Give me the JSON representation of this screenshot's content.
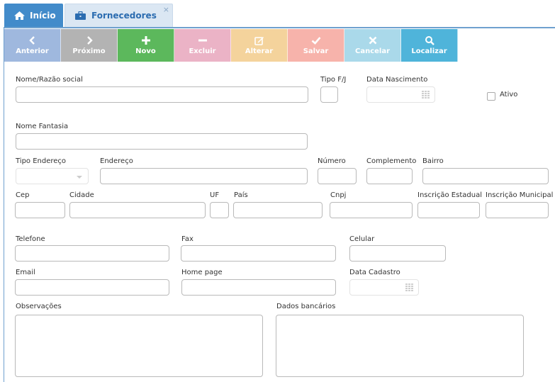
{
  "tabs": {
    "home_label": "Início",
    "suppliers_label": "Fornecedores",
    "close_glyph": "×"
  },
  "toolbar": {
    "anterior": "Anterior",
    "proximo": "Próximo",
    "novo": "Novo",
    "excluir": "Excluir",
    "alterar": "Alterar",
    "salvar": "Salvar",
    "cancelar": "Cancelar",
    "localizar": "Localizar"
  },
  "form": {
    "nome_razao_social": "Nome/Razão social",
    "tipo_fj": "Tipo F/J",
    "data_nascimento": "Data Nascimento",
    "ativo": "Ativo",
    "nome_fantasia": "Nome Fantasia",
    "tipo_endereco": "Tipo Endereço",
    "endereco": "Endereço",
    "numero": "Número",
    "complemento": "Complemento",
    "bairro": "Bairro",
    "cep": "Cep",
    "cidade": "Cidade",
    "uf": "UF",
    "pais": "País",
    "cnpj": "Cnpj",
    "inscricao_estadual": "Inscrição Estadual",
    "inscricao_municipal": "Inscrição Municipal",
    "telefone": "Telefone",
    "fax": "Fax",
    "celular": "Celular",
    "email": "Email",
    "home_page": "Home page",
    "data_cadastro": "Data Cadastro",
    "observacoes": "Observações",
    "dados_bancarios": "Dados bancários"
  },
  "colors": {
    "home_tab": "#428bca",
    "active_tab": "#dbe7f3",
    "frame_border": "#6fa1cf"
  }
}
